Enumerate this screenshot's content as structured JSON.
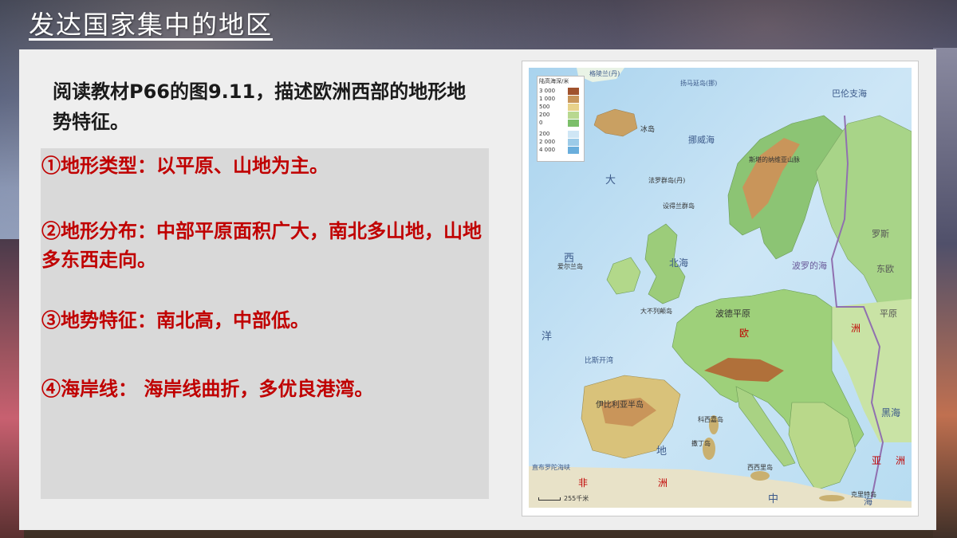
{
  "slide": {
    "title": "发达国家集中的地区",
    "intro": "阅读教材P66的图9.11，描述欧洲西部的地形地势特征。",
    "points": [
      "①地形类型：以平原、山地为主。",
      "②地形分布：中部平原面积广大，南北多山地，山地多东西走向。",
      "③地势特征：南北高，中部低。",
      "④海岸线：  海岸线曲折，多优良港湾。"
    ]
  },
  "map": {
    "legend_title": "陆高海深/米",
    "legend_levels": [
      "3 000",
      "1 000",
      "500",
      "200",
      "0",
      "200",
      "2 000",
      "4 000"
    ],
    "legend_colors": [
      "#a0522d",
      "#c8955a",
      "#e8d28a",
      "#b8d890",
      "#7cbf6a",
      "#cfe6f5",
      "#9ccbe8",
      "#6aaedc"
    ],
    "scale_label": "255千米",
    "labels": [
      "格陵兰(丹)",
      "扬马延岛(挪)",
      "巴伦支海",
      "挪威海",
      "冰岛",
      "大",
      "法罗群岛(丹)",
      "设得兰群岛",
      "西",
      "爱尔兰岛",
      "北海",
      "大不列颠岛",
      "波罗的海",
      "罗斯",
      "东欧",
      "平原",
      "洋",
      "比斯开湾",
      "波德平原",
      "欧",
      "洲",
      "伊比利亚半岛",
      "科西嘉岛",
      "撒丁岛",
      "西西里岛",
      "地",
      "中",
      "海",
      "非",
      "洲",
      "黑海",
      "亚",
      "洲",
      "克里特岛",
      "直布罗陀海峡",
      "斯堪的纳维亚山脉"
    ]
  }
}
